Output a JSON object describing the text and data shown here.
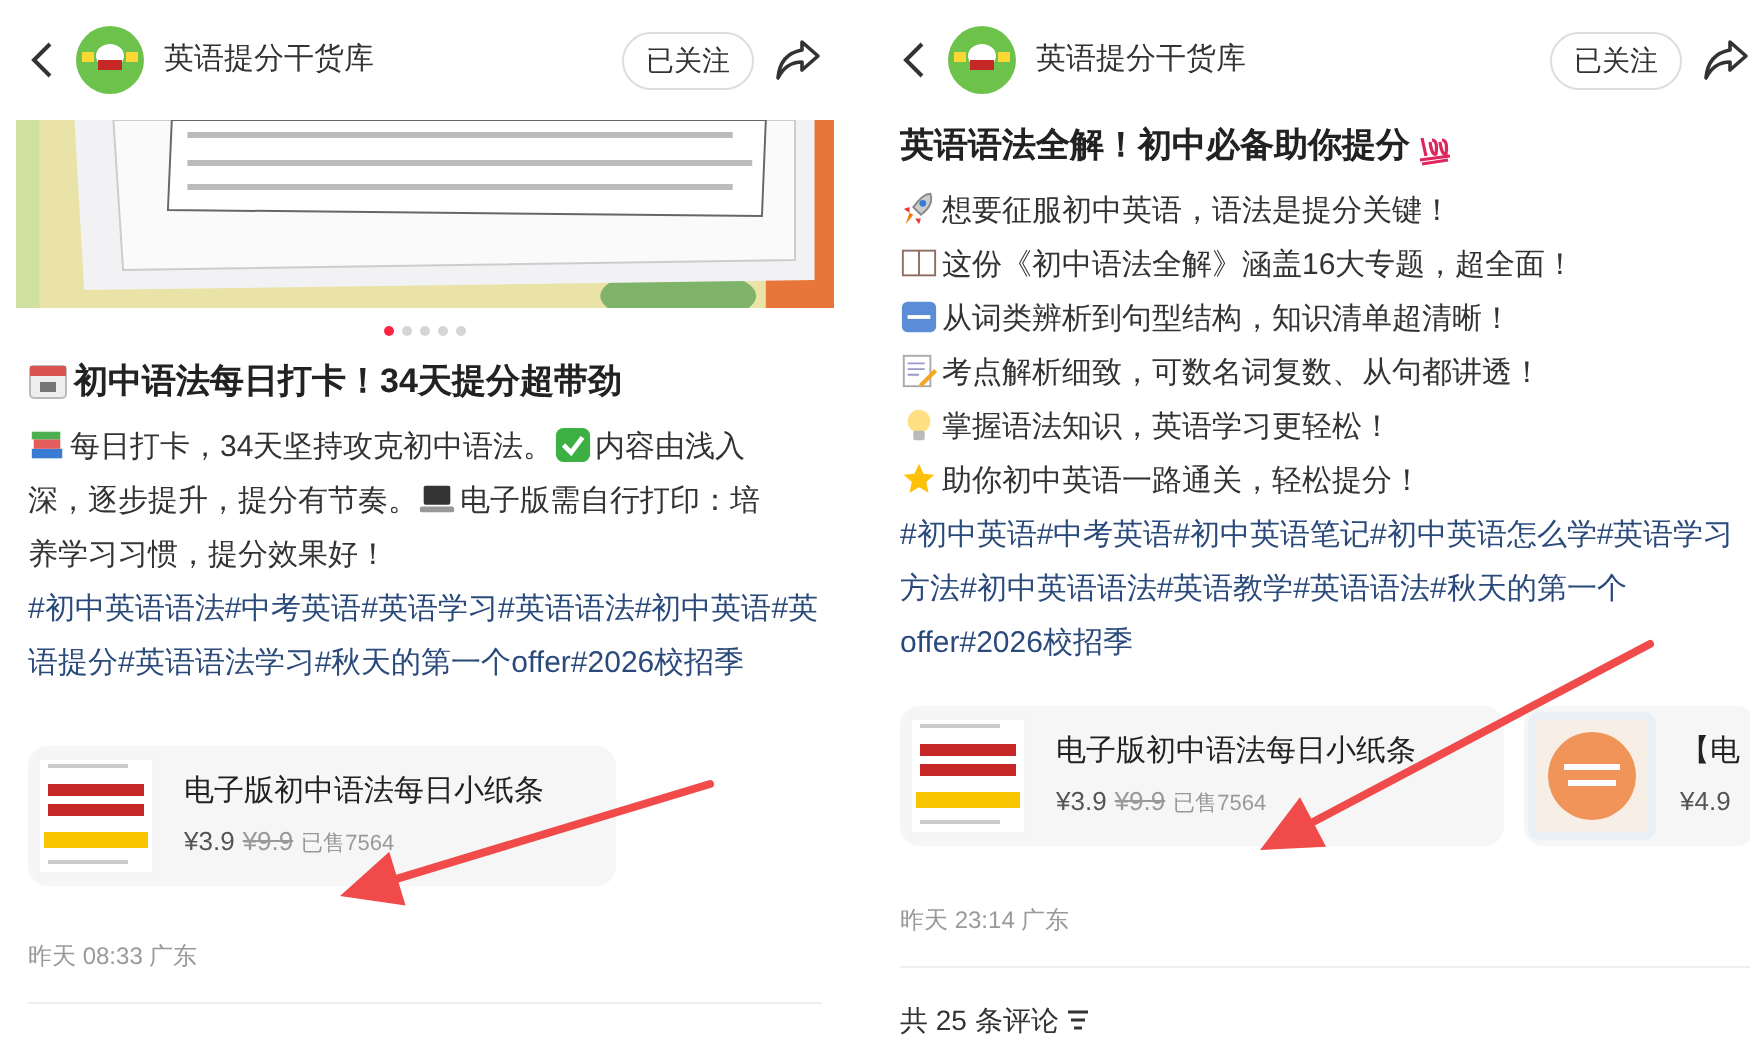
{
  "panels": [
    {
      "header": {
        "author": "英语提分干货库",
        "follow_label": "已关注"
      },
      "carousel": {
        "kind": "picture",
        "dots": [
          {
            "selected": true
          },
          {
            "selected": false
          },
          {
            "selected": false
          },
          {
            "selected": false
          },
          {
            "selected": false
          }
        ]
      },
      "title": {
        "kind": "calendar",
        "text": "初中语法每日打卡！34天提分超带劲"
      },
      "body": [
        [
          {
            "kind": "books",
            "text": "每日打卡，34天坚持攻克初中语法。"
          },
          {
            "kind": "check",
            "text": "内容由浅入"
          }
        ],
        [
          {
            "kind": "plain",
            "text": "深，逐步提升，提分有节奏。"
          },
          {
            "kind": "laptop",
            "text": "电子版需自行打印：培"
          }
        ],
        [
          {
            "kind": "plain",
            "text": "养学习习惯，提分效果好！"
          }
        ]
      ],
      "hashtags": "#初中英语语法#中考英语#英语学习#英语语法#初中英语#英语提分#英语语法学习#秋天的第一个offer#2026校招季",
      "products": [
        {
          "title": "电子版初中语法每日小纸条",
          "price": "¥3.9",
          "original_price": "¥9.9",
          "sold": "已售7564"
        }
      ],
      "meta": "昨天 08:33 广东"
    },
    {
      "header": {
        "author": "英语提分干货库",
        "follow_label": "已关注"
      },
      "title": {
        "kind": "hundred",
        "text": "英语语法全解！初中必备助你提分"
      },
      "body": [
        [
          {
            "kind": "rocket",
            "text": "想要征服初中英语，语法是提分关键！"
          }
        ],
        [
          {
            "kind": "book",
            "text": "这份《初中语法全解》涵盖16大专题，超全面！"
          }
        ],
        [
          {
            "kind": "abc",
            "text": "从词类辨析到句型结构，知识清单超清晰！"
          }
        ],
        [
          {
            "kind": "memo",
            "text": "考点解析细致，可数名词复数、从句都讲透！"
          }
        ],
        [
          {
            "kind": "bulb",
            "text": "掌握语法知识，英语学习更轻松！"
          }
        ],
        [
          {
            "kind": "star",
            "text": "助你初中英语一路通关，轻松提分！"
          }
        ]
      ],
      "hashtags": "#初中英语#中考英语#初中英语笔记#初中英语怎么学#英语学习方法#初中英语语法#英语教学#英语语法#秋天的第一个offer#2026校招季",
      "products": [
        {
          "title": "电子版初中语法每日小纸条",
          "price": "¥3.9",
          "original_price": "¥9.9",
          "sold": "已售7564"
        },
        {
          "title": "【电",
          "price": "¥4.9"
        }
      ],
      "meta": "昨天 23:14 广东",
      "comments": {
        "count_label": "共 25 条评论"
      }
    }
  ]
}
